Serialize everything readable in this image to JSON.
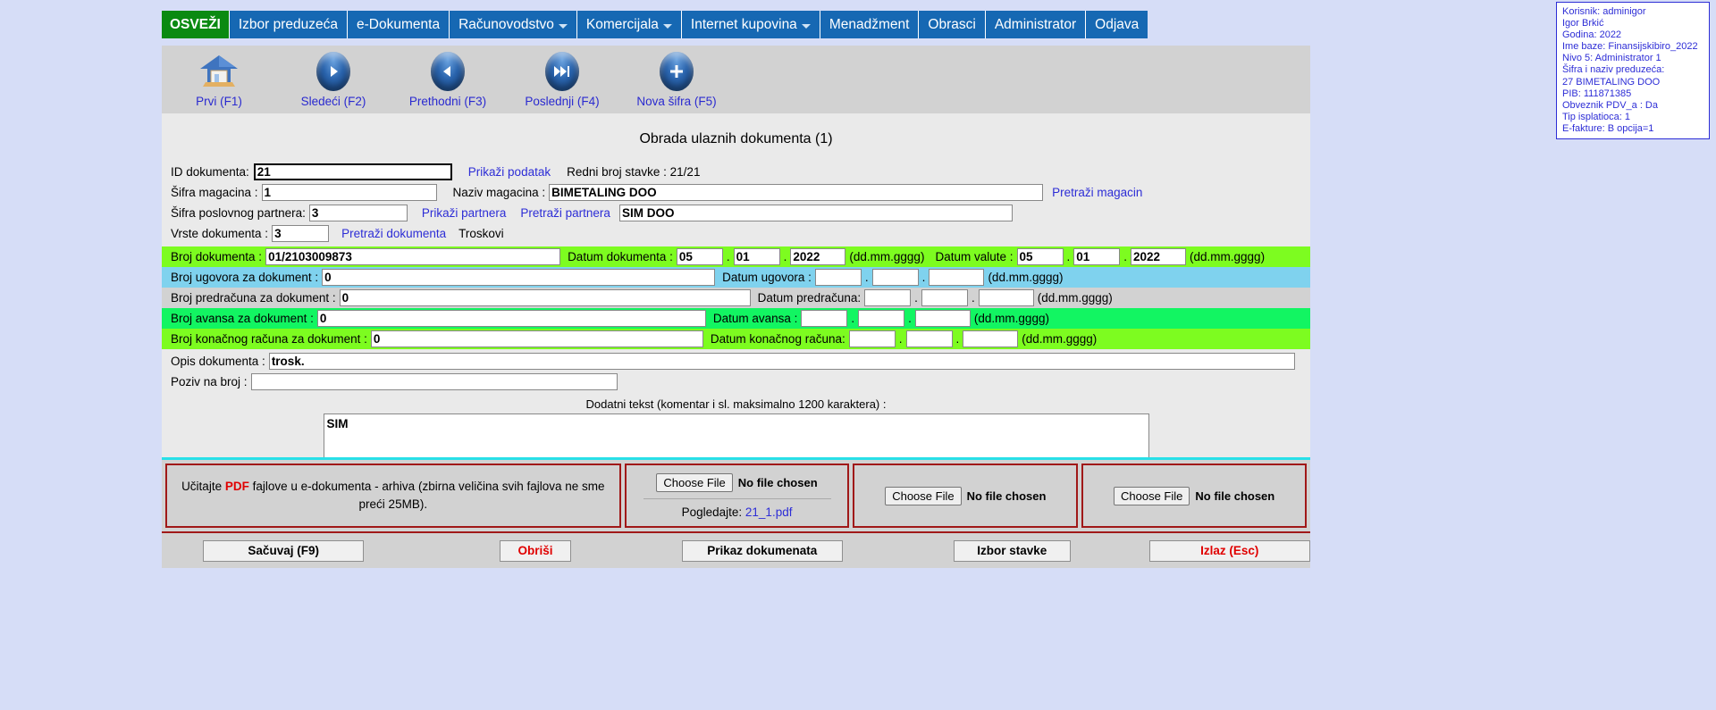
{
  "menu": {
    "items": [
      {
        "label": "OSVEŽI",
        "style": "refresh",
        "caret": false
      },
      {
        "label": "Izbor preduzeća",
        "style": "normal",
        "caret": false
      },
      {
        "label": "e-Dokumenta",
        "style": "normal",
        "caret": false
      },
      {
        "label": "Računovodstvo",
        "style": "normal",
        "caret": true
      },
      {
        "label": "Komercijala",
        "style": "normal",
        "caret": true
      },
      {
        "label": "Internet kupovina",
        "style": "normal",
        "caret": true
      },
      {
        "label": "Menadžment",
        "style": "normal",
        "caret": false
      },
      {
        "label": "Obrasci",
        "style": "normal",
        "caret": false
      },
      {
        "label": "Administrator",
        "style": "normal",
        "caret": false
      },
      {
        "label": "Odjava",
        "style": "normal",
        "caret": false
      }
    ]
  },
  "toolbar": {
    "buttons": [
      {
        "label": "Prvi (F1)",
        "icon": "home-icon"
      },
      {
        "label": "Sledeći (F2)",
        "icon": "play-next-icon"
      },
      {
        "label": "Prethodni (F3)",
        "icon": "play-prev-icon"
      },
      {
        "label": "Poslednji (F4)",
        "icon": "skip-end-icon"
      },
      {
        "label": "Nova šifra (F5)",
        "icon": "plus-icon"
      }
    ]
  },
  "page": {
    "title": "Obrada ulaznih dokumenta (1)"
  },
  "form": {
    "id_dokumenta": {
      "label": "ID dokumenta:",
      "value": "21"
    },
    "prikazi_podatak": "Prikaži podatak",
    "redni_broj_stavke": "Redni broj stavke : 21/21",
    "sifra_magacina": {
      "label": "Šifra magacina :",
      "value": "1"
    },
    "naziv_magacina": {
      "label": "Naziv magacina :",
      "value": "BIMETALING DOO"
    },
    "pretrazi_magacin": "Pretraži magacin",
    "sifra_partnera": {
      "label": "Šifra poslovnog partnera:",
      "value": "3"
    },
    "prikazi_partnera": "Prikaži partnera",
    "pretrazi_partnera": "Pretraži partnera",
    "naziv_partnera": {
      "value": "SIM DOO"
    },
    "vrste_dokumenta": {
      "label": "Vrste dokumenta :",
      "value": "3"
    },
    "pretrazi_dokumenta": "Pretraži dokumenta",
    "vrsta_naziv": "Troskovi",
    "broj_dokumenta": {
      "label": "Broj dokumenta :",
      "value": "01/2103009873"
    },
    "datum_dokumenta": {
      "label": "Datum dokumenta :",
      "dd": "05",
      "mm": "01",
      "gggg": "2022",
      "hint": "(dd.mm.gggg)"
    },
    "datum_valute": {
      "label": "Datum valute :",
      "dd": "05",
      "mm": "01",
      "gggg": "2022",
      "hint": "(dd.mm.gggg)"
    },
    "broj_ugovora": {
      "label": "Broj ugovora za dokument :",
      "value": "0"
    },
    "datum_ugovora": {
      "label": "Datum ugovora :",
      "dd": "",
      "mm": "",
      "gggg": "",
      "hint": "(dd.mm.gggg)"
    },
    "broj_predracuna": {
      "label": "Broj predračuna za dokument :",
      "value": "0"
    },
    "datum_predracuna": {
      "label": "Datum predračuna:",
      "dd": "",
      "mm": "",
      "gggg": "",
      "hint": "(dd.mm.gggg)"
    },
    "broj_avansa": {
      "label": "Broj avansa za dokument :",
      "value": "0"
    },
    "datum_avansa": {
      "label": "Datum avansa :",
      "dd": "",
      "mm": "",
      "gggg": "",
      "hint": "(dd.mm.gggg)"
    },
    "broj_konacnog": {
      "label": "Broj konačnog računa za dokument :",
      "value": "0"
    },
    "datum_konacnog": {
      "label": "Datum konačnog računa:",
      "dd": "",
      "mm": "",
      "gggg": "",
      "hint": "(dd.mm.gggg)"
    },
    "opis_dokumenta": {
      "label": "Opis dokumenta :",
      "value": "trosk."
    },
    "poziv_na_broj": {
      "label": "Poziv na broj :",
      "value": ""
    },
    "dodatni_tekst": {
      "label": "Dodatni tekst (komentar i sl. maksimalno 1200 karaktera) :",
      "value": "SIM"
    }
  },
  "upload": {
    "note_line1_pre": "Učitajte ",
    "note_pdf": "PDF",
    "note_line1_post": " fajlove u e-dokumenta - arhiva (zbirna veličina svih fajlova ne sme",
    "note_line2": "preći 25MB).",
    "choose_file_label": "Choose File",
    "no_file_label": "No file chosen",
    "view_label": "Pogledajte:",
    "view_file": "21_1.pdf"
  },
  "buttons": {
    "save": "Sačuvaj (F9)",
    "delete": "Obriši",
    "show_documents": "Prikaz dokumenata",
    "select_item": "Izbor stavke",
    "exit": "Izlaz (Esc)"
  },
  "info": {
    "lines": [
      "Korisnik: adminigor",
      "Igor Brkić",
      "Godina: 2022",
      "Ime baze: Finansijskibiro_2022",
      "Nivo 5: Administrator 1",
      "Šifra i naziv preduzeća:",
      "27 BIMETALING DOO",
      "PIB: 111871385",
      "Obveznik PDV_a : Da",
      "Tip isplatioca: 1",
      "E-fakture: B opcija=1"
    ]
  },
  "colors": {
    "menu_blue": "#1668b3",
    "refresh_green": "#0a8a11",
    "band_green": "#7dfc20",
    "band_blue": "#7fd2ee",
    "band_green2": "#12f562",
    "accent_red": "#a01818",
    "link_blue": "#2d2dd6"
  }
}
